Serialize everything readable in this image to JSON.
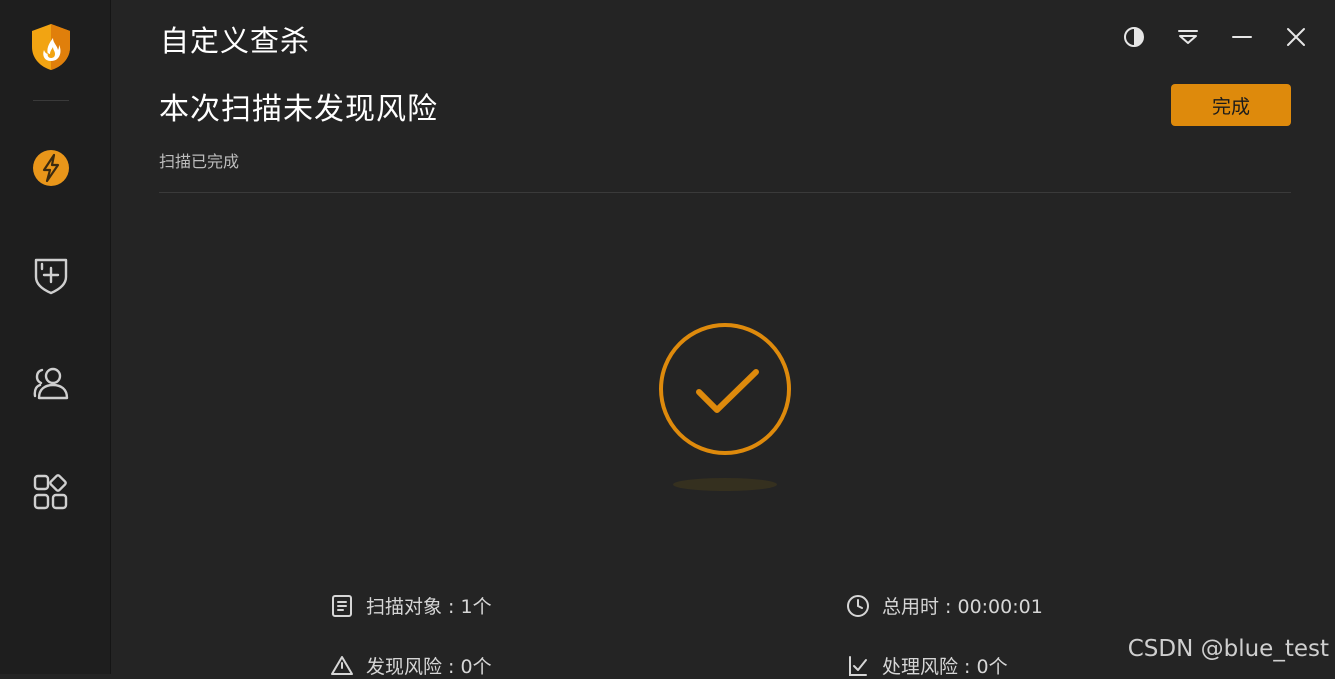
{
  "window": {
    "title": "自定义查杀"
  },
  "sidebar": {
    "items": [
      {
        "icon": "shield-flame-logo-icon"
      },
      {
        "icon": "lightning-icon"
      },
      {
        "icon": "shield-plus-icon"
      },
      {
        "icon": "users-icon"
      },
      {
        "icon": "apps-grid-icon"
      }
    ]
  },
  "window_controls": [
    "theme-toggle-icon",
    "dropdown-menu-icon",
    "minimize-icon",
    "close-icon"
  ],
  "result": {
    "headline": "本次扫描未发现风险",
    "status": "扫描已完成",
    "done_button": "完成"
  },
  "stats": {
    "scanned_objects": "扫描对象 : 1个",
    "total_time": "总用时 : 00:00:01",
    "risks_found": "发现风险 : 0个",
    "risks_handled": "处理风险 : 0个"
  },
  "colors": {
    "accent": "#de8a0c",
    "background": "#242424",
    "sidebar": "#1e1e1e"
  },
  "watermark": "CSDN @blue_test"
}
